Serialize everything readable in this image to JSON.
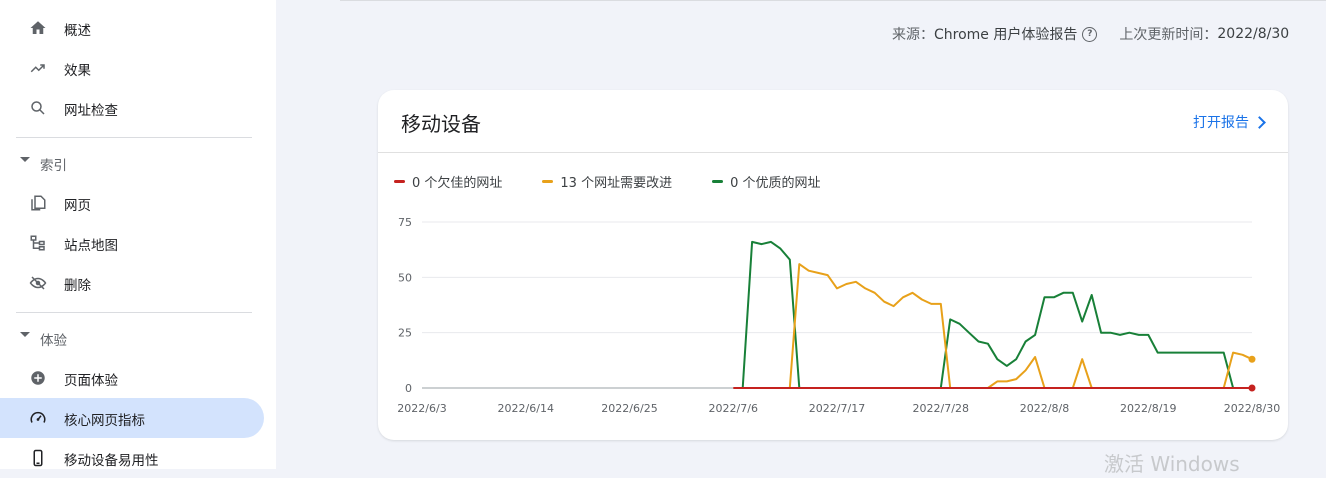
{
  "sidebar": {
    "items_top": [
      {
        "label": "概述",
        "icon": "home-icon"
      },
      {
        "label": "效果",
        "icon": "trending-up-icon"
      },
      {
        "label": "网址检查",
        "icon": "search-icon"
      }
    ],
    "section_index": {
      "label": "索引"
    },
    "items_index": [
      {
        "label": "网页",
        "icon": "pages-icon"
      },
      {
        "label": "站点地图",
        "icon": "sitemap-icon"
      },
      {
        "label": "删除",
        "icon": "visibility-off-icon"
      }
    ],
    "section_experience": {
      "label": "体验"
    },
    "items_experience": [
      {
        "label": "页面体验",
        "icon": "page-experience-icon"
      },
      {
        "label": "核心网页指标",
        "icon": "speed-icon"
      },
      {
        "label": "移动设备易用性",
        "icon": "mobile-icon"
      }
    ]
  },
  "header": {
    "source_label": "来源：",
    "source_value": "Chrome 用户体验报告",
    "updated_label": "上次更新时间：",
    "updated_value": "2022/8/30"
  },
  "card": {
    "title": "移动设备",
    "open_report": "打开报告"
  },
  "watermark": "激活 Windows",
  "colors": {
    "poor": "#c5221f",
    "needs_improvement": "#e8a11a",
    "good": "#188038",
    "accent": "#1a73e8",
    "active_nav": "#d3e3fd"
  },
  "chart_data": {
    "type": "line",
    "title": "",
    "xlabel": "",
    "ylabel": "",
    "ylim": [
      0,
      75
    ],
    "yticks": [
      0,
      25,
      50,
      75
    ],
    "xticks": [
      "2022/6/3",
      "2022/6/14",
      "2022/6/25",
      "2022/7/6",
      "2022/7/17",
      "2022/7/28",
      "2022/8/8",
      "2022/8/19",
      "2022/8/30"
    ],
    "x_start": "2022/6/3",
    "grid": true,
    "legend_position": "top-left",
    "series": [
      {
        "name": "0 个欠佳的网址",
        "color": "#c5221f",
        "points": [
          [
            33,
            0
          ],
          [
            88,
            0
          ]
        ],
        "end_marker": true
      },
      {
        "name": "13 个网址需要改进",
        "color": "#e8a11a",
        "points": [
          [
            39,
            0
          ],
          [
            40,
            56
          ],
          [
            41,
            53
          ],
          [
            42,
            52
          ],
          [
            43,
            51
          ],
          [
            44,
            45
          ],
          [
            45,
            47
          ],
          [
            46,
            48
          ],
          [
            47,
            45
          ],
          [
            48,
            43
          ],
          [
            49,
            39
          ],
          [
            50,
            37
          ],
          [
            51,
            41
          ],
          [
            52,
            43
          ],
          [
            53,
            40
          ],
          [
            54,
            38
          ],
          [
            55,
            38
          ],
          [
            56,
            0
          ],
          [
            60,
            0
          ],
          [
            61,
            3
          ],
          [
            62,
            3
          ],
          [
            63,
            4
          ],
          [
            64,
            8
          ],
          [
            65,
            14
          ],
          [
            66,
            0
          ],
          [
            69,
            0
          ],
          [
            70,
            13
          ],
          [
            71,
            0
          ],
          [
            85,
            0
          ],
          [
            86,
            16
          ],
          [
            87,
            15
          ],
          [
            88,
            13
          ]
        ],
        "end_marker": true
      },
      {
        "name": "0 个优质的网址",
        "color": "#188038",
        "points": [
          [
            34,
            0
          ],
          [
            35,
            66
          ],
          [
            36,
            65
          ],
          [
            37,
            66
          ],
          [
            38,
            63
          ],
          [
            39,
            58
          ],
          [
            40,
            0
          ],
          [
            55,
            0
          ],
          [
            56,
            31
          ],
          [
            57,
            29
          ],
          [
            58,
            25
          ],
          [
            59,
            21
          ],
          [
            60,
            20
          ],
          [
            61,
            13
          ],
          [
            62,
            10
          ],
          [
            63,
            13
          ],
          [
            64,
            21
          ],
          [
            65,
            24
          ],
          [
            66,
            41
          ],
          [
            67,
            41
          ],
          [
            68,
            43
          ],
          [
            69,
            43
          ],
          [
            70,
            30
          ],
          [
            71,
            42
          ],
          [
            72,
            25
          ],
          [
            73,
            25
          ],
          [
            74,
            24
          ],
          [
            75,
            25
          ],
          [
            76,
            24
          ],
          [
            77,
            24
          ],
          [
            78,
            16
          ],
          [
            79,
            16
          ],
          [
            80,
            16
          ],
          [
            81,
            16
          ],
          [
            82,
            16
          ],
          [
            83,
            16
          ],
          [
            84,
            16
          ],
          [
            85,
            16
          ],
          [
            86,
            0
          ]
        ],
        "end_marker": false
      }
    ]
  }
}
